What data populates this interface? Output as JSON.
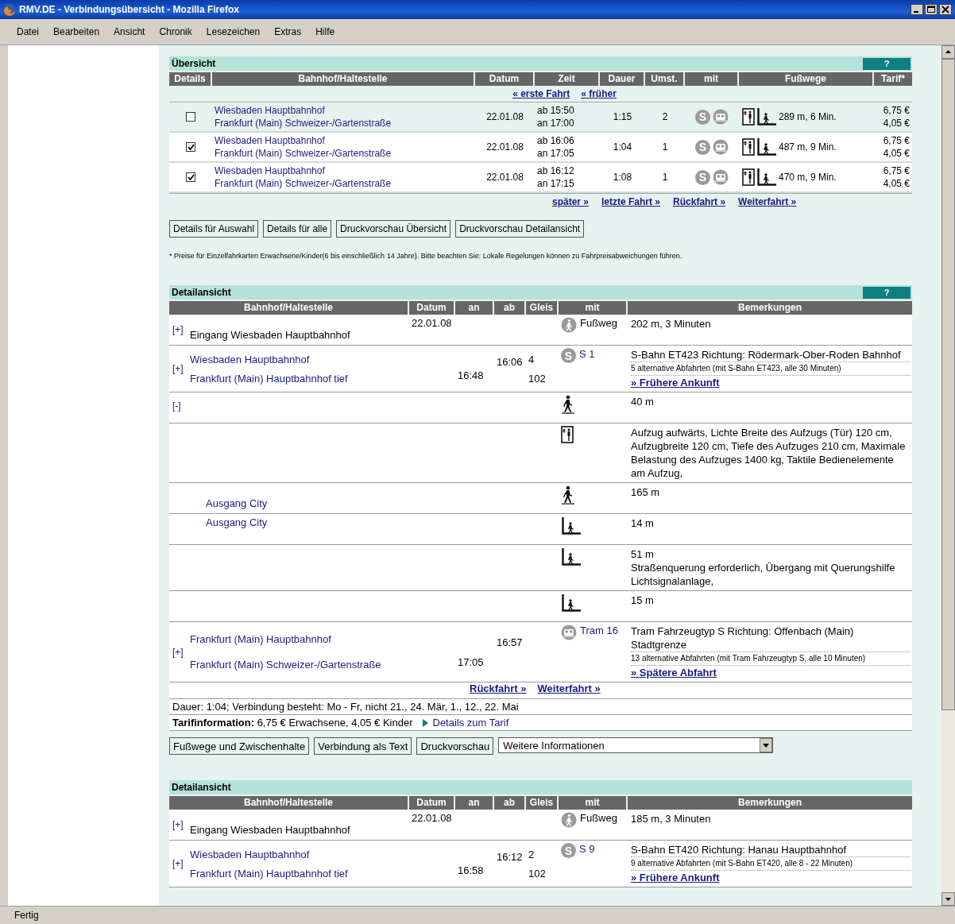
{
  "window": {
    "title": "RMV.DE - Verbindungsübersicht - Mozilla Firefox"
  },
  "menu": [
    "Datei",
    "Bearbeiten",
    "Ansicht",
    "Chronik",
    "Lesezeichen",
    "Extras",
    "Hilfe"
  ],
  "overview": {
    "title": "Übersicht",
    "help": "?",
    "columns": [
      "Details",
      "Bahnhof/Haltestelle",
      "Datum",
      "Zeit",
      "Dauer",
      "Umst.",
      "mit",
      "Fußwege",
      "Tarif*"
    ],
    "nav_top": [
      "« erste Fahrt",
      "« früher"
    ],
    "rows": [
      {
        "checked": false,
        "from": "Wiesbaden Hauptbahnhof",
        "to": "Frankfurt (Main) Schweizer-/Gartenstraße",
        "date": "22.01.08",
        "departure": "ab 15:50",
        "arrival": "an 17:00",
        "duration": "1:15",
        "changes": "2",
        "modes": [
          {
            "kind": "sbahn",
            "glyph": "S"
          },
          {
            "kind": "tram"
          }
        ],
        "walk": "289 m, 6 Min.",
        "fares": [
          "6,75 €",
          "4,05 €"
        ]
      },
      {
        "checked": true,
        "from": "Wiesbaden Hauptbahnhof",
        "to": "Frankfurt (Main) Schweizer-/Gartenstraße",
        "date": "22.01.08",
        "departure": "ab 16:06",
        "arrival": "an 17:05",
        "duration": "1:04",
        "changes": "1",
        "modes": [
          {
            "kind": "sbahn",
            "glyph": "S"
          },
          {
            "kind": "tram"
          }
        ],
        "walk": "487 m, 9 Min.",
        "fares": [
          "6,75 €",
          "4,05 €"
        ]
      },
      {
        "checked": true,
        "from": "Wiesbaden Hauptbahnhof",
        "to": "Frankfurt (Main) Schweizer-/Gartenstraße",
        "date": "22.01.08",
        "departure": "ab 16:12",
        "arrival": "an 17:15",
        "duration": "1:08",
        "changes": "1",
        "modes": [
          {
            "kind": "sbahn",
            "glyph": "S"
          },
          {
            "kind": "tram"
          }
        ],
        "walk": "470 m, 9 Min.",
        "fares": [
          "6,75 €",
          "4,05 €"
        ]
      }
    ],
    "nav_bottom": [
      "später »",
      "letzte Fahrt »",
      "Rückfahrt »",
      "Weiterfahrt »"
    ],
    "buttons": [
      "Details für Auswahl",
      "Details für alle",
      "Druckvorschau Übersicht",
      "Druckvorschau Detailansicht"
    ],
    "footnote": "* Preise für Einzelfahrkarten Erwachsene/Kinder(6 bis einschließlich 14 Jahre). Bitte beachten Sie: Lokale Regelungen können zu Fahrpreisabweichungen führen."
  },
  "details": [
    {
      "title": "Detailansicht",
      "help": "?",
      "columns": [
        "Bahnhof/Haltestelle",
        "Datum",
        "an",
        "ab",
        "Gleis",
        "mit",
        "Bemerkungen"
      ],
      "rows": [
        {
          "kind": "walk",
          "toggle": "[+]",
          "station": "Eingang Wiesbaden Hauptbahnhof",
          "date": "22.01.08",
          "mode": {
            "kind": "walk",
            "label": "Fußweg"
          },
          "remark": "202 m, 3 Minuten"
        },
        {
          "kind": "leg",
          "toggle": "[+]",
          "from": {
            "station": "Wiesbaden Hauptbahnhof",
            "time": "16:06",
            "track": "4"
          },
          "to": {
            "station": "Frankfurt (Main) Hauptbahnhof tief",
            "time": "16:48",
            "track": "102"
          },
          "mode": {
            "kind": "sbahn",
            "glyph": "S",
            "label": "S 1"
          },
          "remark": "S-Bahn ET423 Richtung: Rödermark-Ober-Roden Bahnhof",
          "alternatives": "5 alternative Abfahrten (mit S-Bahn ET423, alle 30 Minuten)",
          "link": "» Frühere Ankunft"
        },
        {
          "kind": "footpath",
          "toggle": "[-]",
          "remark": "40 m"
        },
        {
          "kind": "elevator",
          "remark": "Aufzug aufwärts, Lichte Breite des Aufzugs (Tür) 120 cm, Aufzugbreite 120 cm, Tiefe des Aufzuges 210 cm, Maximale Belastung des Aufzuges 1400 kg, Taktile Bedienelemente am Aufzug,"
        },
        {
          "kind": "footpath",
          "to": "Ausgang City",
          "remark": "165 m"
        },
        {
          "kind": "stairway",
          "from": "Ausgang City",
          "remark": "14 m"
        },
        {
          "kind": "stairway",
          "remark": "51 m",
          "note": "Straßenquerung erforderlich, Übergang mit Querungshilfe Lichtsignalanlage,"
        },
        {
          "kind": "stairway",
          "remark": "15 m"
        },
        {
          "kind": "leg",
          "toggle": "[+]",
          "from": {
            "station": "Frankfurt (Main) Hauptbahnhof",
            "time": "16:57"
          },
          "to": {
            "station": "Frankfurt (Main) Schweizer-/Gartenstraße",
            "time": "17:05"
          },
          "mode": {
            "kind": "tram",
            "label": "Tram 16"
          },
          "remark": "Tram Fahrzeugtyp S Richtung: Offenbach (Main) Stadtgrenze",
          "alternatives": "13 alternative Abfahrten (mit Tram Fahrzeugtyp S, alle 10 Minuten)",
          "link": "» Spätere Abfahrt"
        }
      ],
      "nav": [
        "Rückfahrt »",
        "Weiterfahrt »"
      ],
      "duration": "Dauer: 1:04; Verbindung besteht: Mo - Fr, nicht 21., 24. Mär, 1., 12., 22. Mai",
      "fare": "**Tarifinformation:** 6,75 € Erwachsene, 4,05 € Kinder",
      "fare_link": "Details zum Tarif",
      "buttons": [
        "Fußwege und Zwischenhalte",
        "Verbindung als Text",
        "Druckvorschau"
      ],
      "select": "Weitere Informationen"
    },
    {
      "title": "Detailansicht",
      "columns": [
        "Bahnhof/Haltestelle",
        "Datum",
        "an",
        "ab",
        "Gleis",
        "mit",
        "Bemerkungen"
      ],
      "rows": [
        {
          "kind": "walk",
          "toggle": "[+]",
          "station": "Eingang Wiesbaden Hauptbahnhof",
          "date": "22.01.08",
          "mode": {
            "kind": "walk",
            "label": "Fußweg"
          },
          "remark": "185 m, 3 Minuten"
        },
        {
          "kind": "leg",
          "toggle": "[+]",
          "from": {
            "station": "Wiesbaden Hauptbahnhof",
            "time": "16:12",
            "track": "2"
          },
          "to": {
            "station": "Frankfurt (Main) Hauptbahnhof tief",
            "time": "16:58",
            "track": "102"
          },
          "mode": {
            "kind": "sbahn",
            "glyph": "S",
            "label": "S 9"
          },
          "remark": "S-Bahn ET420 Richtung: Hanau Hauptbahnhof",
          "alternatives": "9 alternative Abfahrten (mit S-Bahn ET420, alle 8 - 22 Minuten)",
          "link": "» Frühere Ankunft"
        }
      ]
    }
  ],
  "status_bar": "Fertig"
}
